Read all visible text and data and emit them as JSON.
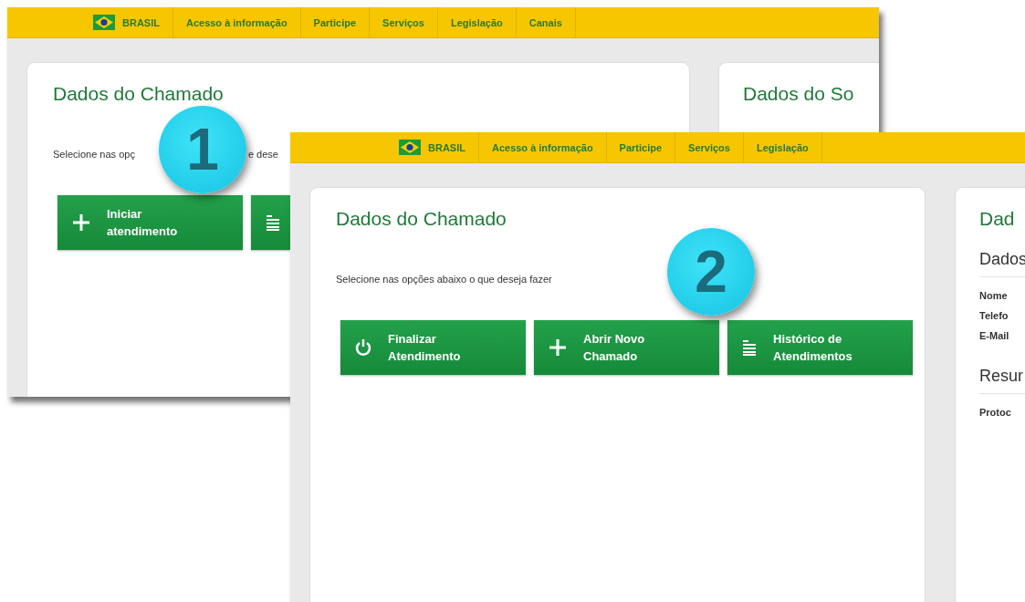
{
  "screens": [
    {
      "nav": [
        {
          "kind": "flag",
          "label": "BRASIL"
        },
        {
          "kind": "link",
          "label": "Acesso à informação"
        },
        {
          "kind": "link",
          "label": "Participe"
        },
        {
          "kind": "link",
          "label": "Serviços"
        },
        {
          "kind": "link",
          "label": "Legislação"
        },
        {
          "kind": "link",
          "label": "Canais"
        }
      ],
      "main_card": {
        "title": "Dados do Chamado",
        "instruction_parts": [
          "Selecione nas opç",
          "e dese"
        ],
        "buttons": [
          {
            "kind": "add",
            "label": "Iniciar atendimento"
          },
          {
            "kind": "history"
          }
        ]
      },
      "side_card": {
        "title": "Dados do So"
      },
      "badge": "1"
    },
    {
      "nav": [
        {
          "kind": "flag",
          "label": "BRASIL"
        },
        {
          "kind": "link",
          "label": "Acesso à informação"
        },
        {
          "kind": "link",
          "label": "Participe"
        },
        {
          "kind": "link",
          "label": "Serviços"
        },
        {
          "kind": "link",
          "label": "Legislação"
        }
      ],
      "main_card": {
        "title": "Dados do Chamado",
        "instruction_parts": [
          "Selecione nas opções abaixo o que deseja fazer"
        ],
        "buttons": [
          {
            "kind": "finish",
            "label": "Finalizar Atendimento"
          },
          {
            "kind": "add",
            "label": "Abrir Novo Chamado"
          },
          {
            "kind": "history",
            "label": "Histórico de Atendimentos"
          }
        ]
      },
      "side_card": {
        "title": "Dad",
        "lines": [
          {
            "kind": "heading",
            "text": "Dados"
          },
          {
            "kind": "field",
            "text": "Nome"
          },
          {
            "kind": "field",
            "text": "Telefo"
          },
          {
            "kind": "field",
            "text": "E-Mail"
          },
          {
            "kind": "heading",
            "text": "Resur"
          },
          {
            "kind": "field",
            "text": "Protoc"
          }
        ]
      },
      "badge": "2"
    }
  ]
}
